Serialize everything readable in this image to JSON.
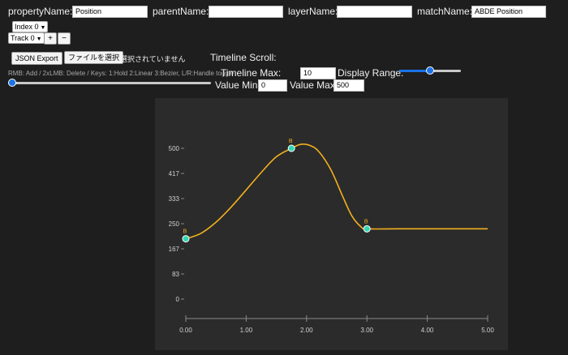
{
  "header": {
    "property_label": "propertyName:",
    "property_value": "Position",
    "parent_label": "parentName:",
    "parent_value": "",
    "layer_label": "layerName:",
    "layer_value": "",
    "match_label": "matchName:",
    "match_value": "ABDE Position"
  },
  "selectors": {
    "index_value": "Index 0",
    "track_value": "Track 0",
    "add_label": "+",
    "remove_label": "−"
  },
  "toolbar": {
    "json_export_label": "JSON Export",
    "file_button_label": "ファイルを選択",
    "file_status": "選択されていません",
    "timeline_scroll_label": "Timeline Scroll:",
    "hint": "RMB: Add / 2xLMB: Delete / Keys: 1:Hold 2:Linear 3:Bezier, L/R:Handle toggle",
    "timeline_max_label": "Timeline Max:",
    "timeline_max_value": "10",
    "display_range_label": "Display Range:",
    "display_range_level": 0.5,
    "timeline_scroll_level": 0.0,
    "value_min_label": "Value Min:",
    "value_min_value": "0",
    "value_max_label": "Value Max:",
    "value_max_value": "500"
  },
  "colors": {
    "curve": "#f2b01e",
    "keyframe_fill": "#34d6b4",
    "keyframe_label": "#f2b01e",
    "axis": "#8a8a8a",
    "slider_accent": "#1a73e8"
  },
  "chart_data": {
    "type": "line",
    "xlim": [
      0,
      5
    ],
    "ylim": [
      0,
      500
    ],
    "x_ticks": [
      "0.00",
      "1.00",
      "2.00",
      "3.00",
      "4.00",
      "5.00"
    ],
    "x_tick_values": [
      0,
      1,
      2,
      3,
      4,
      5
    ],
    "y_ticks": [
      "0",
      "83",
      "167",
      "250",
      "333",
      "417",
      "500"
    ],
    "y_tick_values": [
      0,
      83.33,
      166.67,
      250,
      333.33,
      416.67,
      500
    ],
    "keyframes": [
      {
        "t": 0.0,
        "v": 200,
        "label": "B"
      },
      {
        "t": 1.75,
        "v": 500,
        "label": "B"
      },
      {
        "t": 3.0,
        "v": 233,
        "label": "B"
      }
    ],
    "curve": [
      [
        0.0,
        200
      ],
      [
        0.25,
        218
      ],
      [
        0.5,
        255
      ],
      [
        0.75,
        305
      ],
      [
        1.0,
        362
      ],
      [
        1.25,
        420
      ],
      [
        1.5,
        472
      ],
      [
        1.75,
        500
      ],
      [
        1.9,
        513
      ],
      [
        2.05,
        510
      ],
      [
        2.2,
        490
      ],
      [
        2.4,
        430
      ],
      [
        2.6,
        340
      ],
      [
        2.75,
        276
      ],
      [
        2.9,
        240
      ],
      [
        3.0,
        233
      ],
      [
        3.5,
        233
      ],
      [
        4.0,
        233
      ],
      [
        4.5,
        233
      ],
      [
        5.0,
        233
      ]
    ],
    "grid": false
  }
}
